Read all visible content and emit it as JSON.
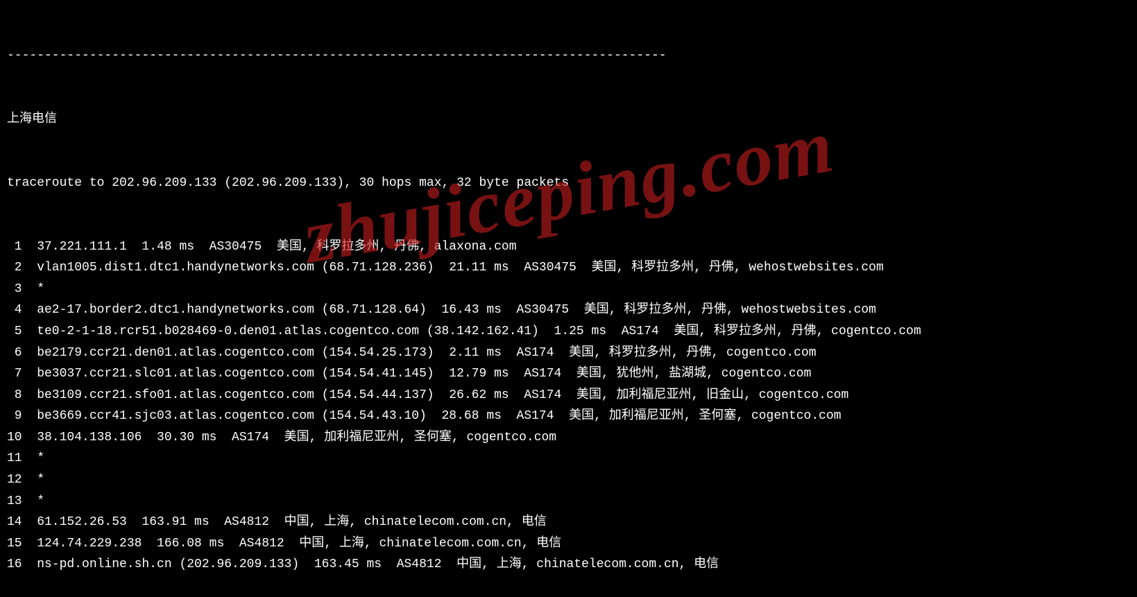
{
  "watermark": "zhujiceping.com",
  "divider": "----------------------------------------------------------------------------------------",
  "header": "上海电信",
  "traceroute_cmd": "traceroute to 202.96.209.133 (202.96.209.133), 30 hops max, 32 byte packets",
  "hops": [
    {
      "n": " 1",
      "text": "  37.221.111.1  1.48 ms  AS30475  美国, 科罗拉多州, 丹佛, alaxona.com"
    },
    {
      "n": " 2",
      "text": "  vlan1005.dist1.dtc1.handynetworks.com (68.71.128.236)  21.11 ms  AS30475  美国, 科罗拉多州, 丹佛, wehostwebsites.com"
    },
    {
      "n": " 3",
      "text": "  *"
    },
    {
      "n": " 4",
      "text": "  ae2-17.border2.dtc1.handynetworks.com (68.71.128.64)  16.43 ms  AS30475  美国, 科罗拉多州, 丹佛, wehostwebsites.com"
    },
    {
      "n": " 5",
      "text": "  te0-2-1-18.rcr51.b028469-0.den01.atlas.cogentco.com (38.142.162.41)  1.25 ms  AS174  美国, 科罗拉多州, 丹佛, cogentco.com"
    },
    {
      "n": " 6",
      "text": "  be2179.ccr21.den01.atlas.cogentco.com (154.54.25.173)  2.11 ms  AS174  美国, 科罗拉多州, 丹佛, cogentco.com"
    },
    {
      "n": " 7",
      "text": "  be3037.ccr21.slc01.atlas.cogentco.com (154.54.41.145)  12.79 ms  AS174  美国, 犹他州, 盐湖城, cogentco.com"
    },
    {
      "n": " 8",
      "text": "  be3109.ccr21.sfo01.atlas.cogentco.com (154.54.44.137)  26.62 ms  AS174  美国, 加利福尼亚州, 旧金山, cogentco.com"
    },
    {
      "n": " 9",
      "text": "  be3669.ccr41.sjc03.atlas.cogentco.com (154.54.43.10)  28.68 ms  AS174  美国, 加利福尼亚州, 圣何塞, cogentco.com"
    },
    {
      "n": "10",
      "text": "  38.104.138.106  30.30 ms  AS174  美国, 加利福尼亚州, 圣何塞, cogentco.com"
    },
    {
      "n": "11",
      "text": "  *"
    },
    {
      "n": "12",
      "text": "  *"
    },
    {
      "n": "13",
      "text": "  *"
    },
    {
      "n": "14",
      "text": "  61.152.26.53  163.91 ms  AS4812  中国, 上海, chinatelecom.com.cn, 电信"
    },
    {
      "n": "15",
      "text": "  124.74.229.238  166.08 ms  AS4812  中国, 上海, chinatelecom.com.cn, 电信"
    },
    {
      "n": "16",
      "text": "  ns-pd.online.sh.cn (202.96.209.133)  163.45 ms  AS4812  中国, 上海, chinatelecom.com.cn, 电信"
    }
  ]
}
